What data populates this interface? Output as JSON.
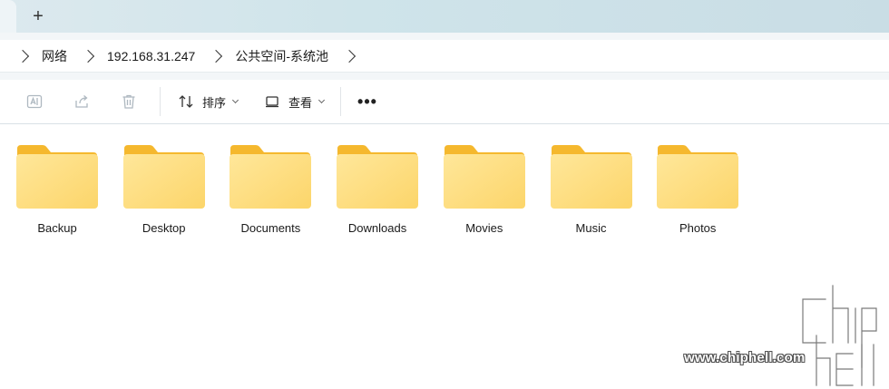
{
  "tabstrip": {
    "new_tab_label": "+"
  },
  "breadcrumb": {
    "items": [
      "网络",
      "192.168.31.247",
      "公共空间-系统池"
    ]
  },
  "toolbar": {
    "sort_label": "排序",
    "view_label": "查看",
    "more_label": "•••"
  },
  "folders": [
    {
      "name": "Backup"
    },
    {
      "name": "Desktop"
    },
    {
      "name": "Documents"
    },
    {
      "name": "Downloads"
    },
    {
      "name": "Movies"
    },
    {
      "name": "Music"
    },
    {
      "name": "Photos"
    }
  ],
  "colors": {
    "folder_back": "#f5b82e",
    "folder_front": "#fcd56a",
    "accent": "#0a66c2"
  },
  "watermark": {
    "logo_text": "chiphell",
    "url": "www.chiphell.com"
  }
}
